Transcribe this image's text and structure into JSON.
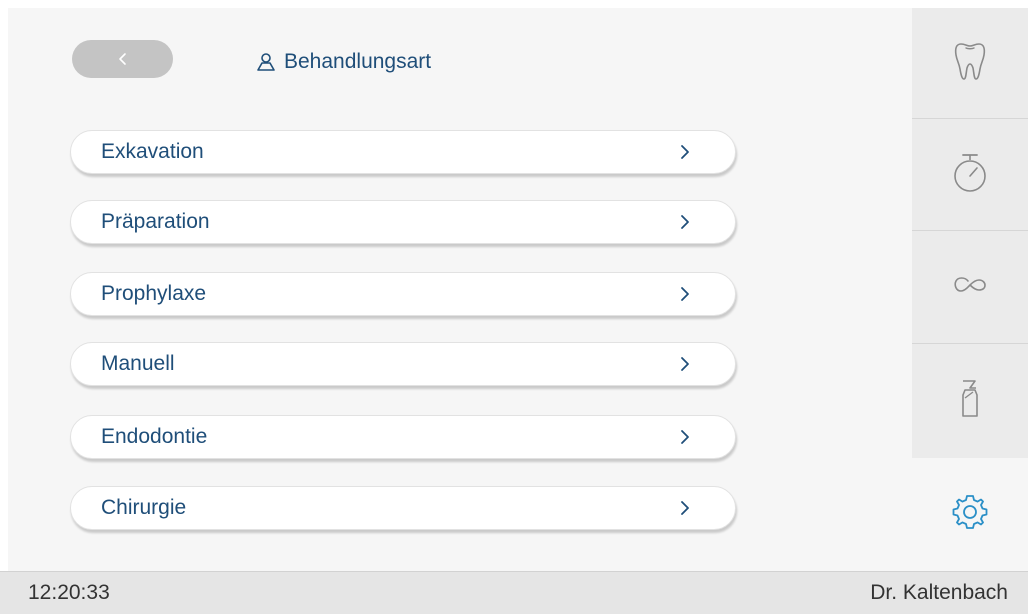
{
  "header": {
    "title": "Behandlungsart",
    "back_icon": "chevron-left-icon",
    "title_icon": "person-icon"
  },
  "menu": {
    "items": [
      {
        "label": "Exkavation"
      },
      {
        "label": "Präparation"
      },
      {
        "label": "Prophylaxe"
      },
      {
        "label": "Manuell"
      },
      {
        "label": "Endodontie"
      },
      {
        "label": "Chirurgie"
      }
    ],
    "chevron_icon": "chevron-right-icon"
  },
  "rail": {
    "items": [
      {
        "icon": "tooth-icon"
      },
      {
        "icon": "stopwatch-icon"
      },
      {
        "icon": "infinity-loop-icon"
      },
      {
        "icon": "spray-bottle-icon"
      }
    ],
    "settings_icon": "gear-icon"
  },
  "status": {
    "time": "12:20:33",
    "user": "Dr. Kaltenbach"
  },
  "colors": {
    "text_blue": "#1f4e79",
    "accent_blue": "#2a8fc7",
    "panel": "#f6f6f6",
    "rail": "#ebebeb",
    "statusbar": "#e5e5e5"
  }
}
